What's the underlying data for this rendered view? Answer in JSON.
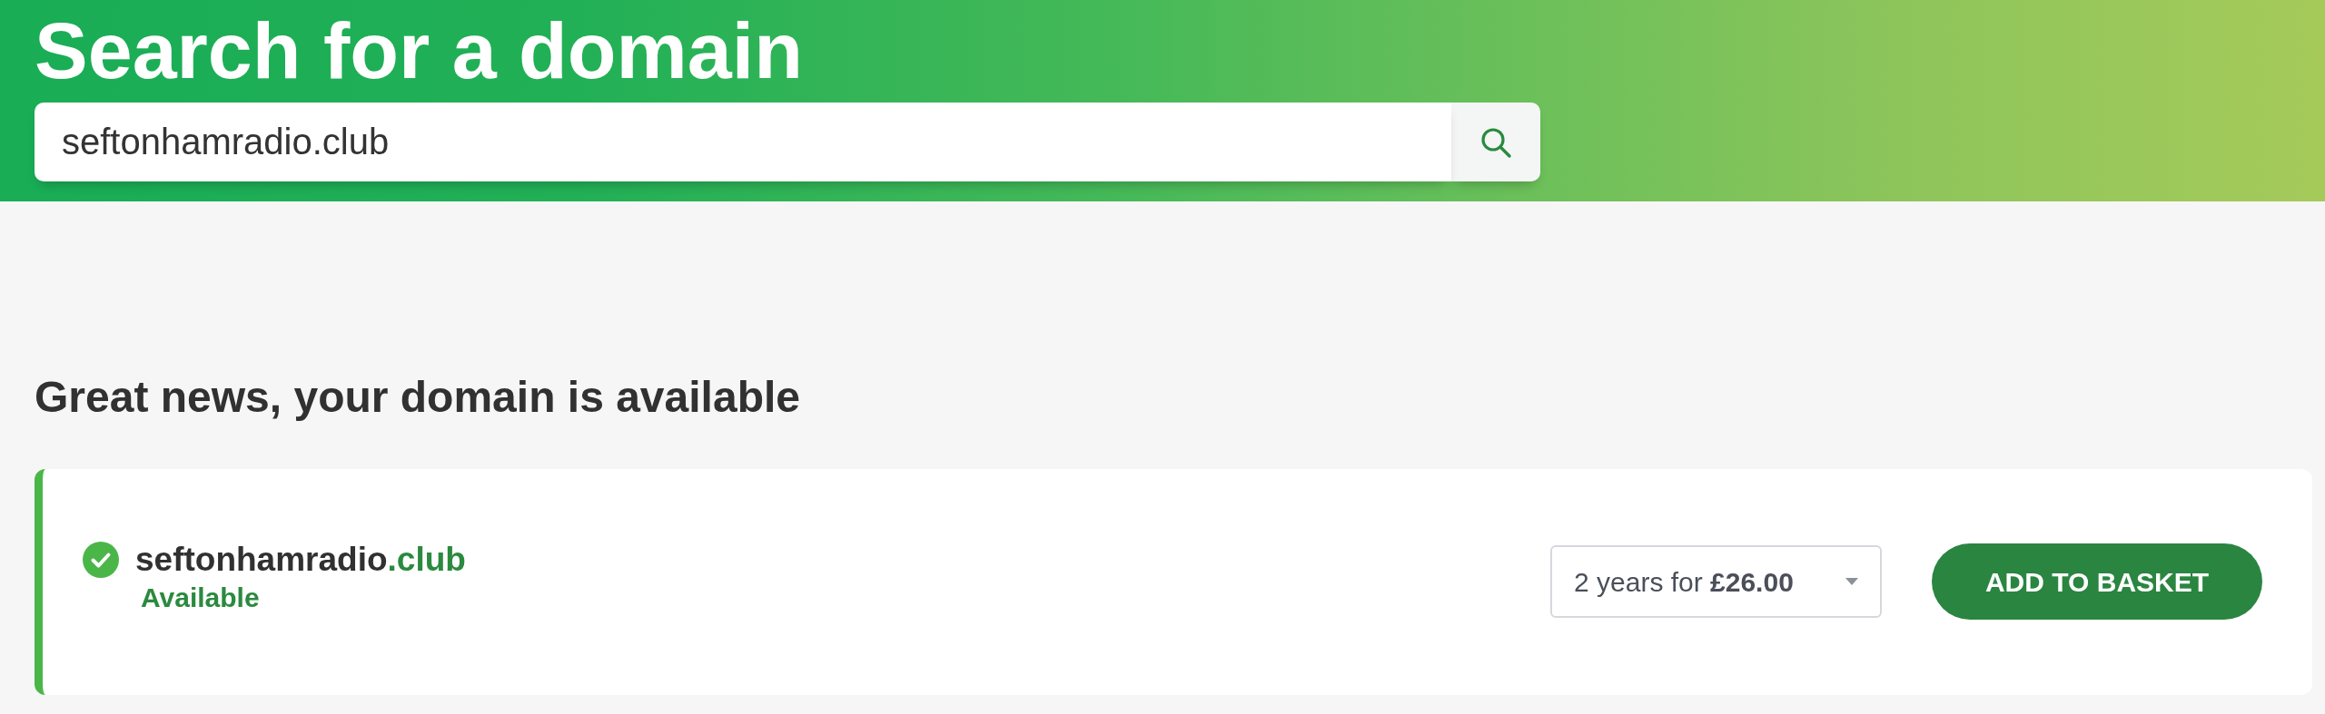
{
  "header": {
    "title": "Search for a domain",
    "search": {
      "value": "seftonhamradio.club"
    }
  },
  "results": {
    "heading": "Great news, your domain is available",
    "items": [
      {
        "name": "seftonhamradio",
        "extension": ".club",
        "available": true,
        "status": "Available",
        "term": "2 years for **£26.00**",
        "button": "ADD TO BASKET"
      }
    ]
  }
}
